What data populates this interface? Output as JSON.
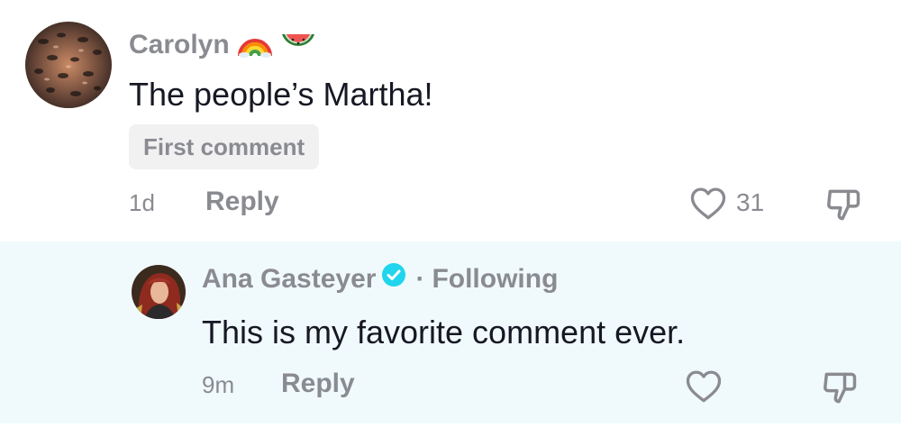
{
  "comments": [
    {
      "author": "Carolyn",
      "author_emojis": [
        "rainbow-emoji",
        "watermelon-emoji"
      ],
      "text": "The people’s Martha!",
      "badge": "First comment",
      "time": "1d",
      "reply_label": "Reply",
      "like_count": "31"
    },
    {
      "author": "Ana Gasteyer",
      "verified": true,
      "separator": "·",
      "following_label": "Following",
      "text": "This is my favorite comment ever.",
      "time": "9m",
      "reply_label": "Reply",
      "like_count": ""
    }
  ],
  "colors": {
    "reply_background": "#f0fafd",
    "verified": "#20d5ec",
    "secondary_text": "#8a8b91",
    "primary_text": "#161823"
  }
}
